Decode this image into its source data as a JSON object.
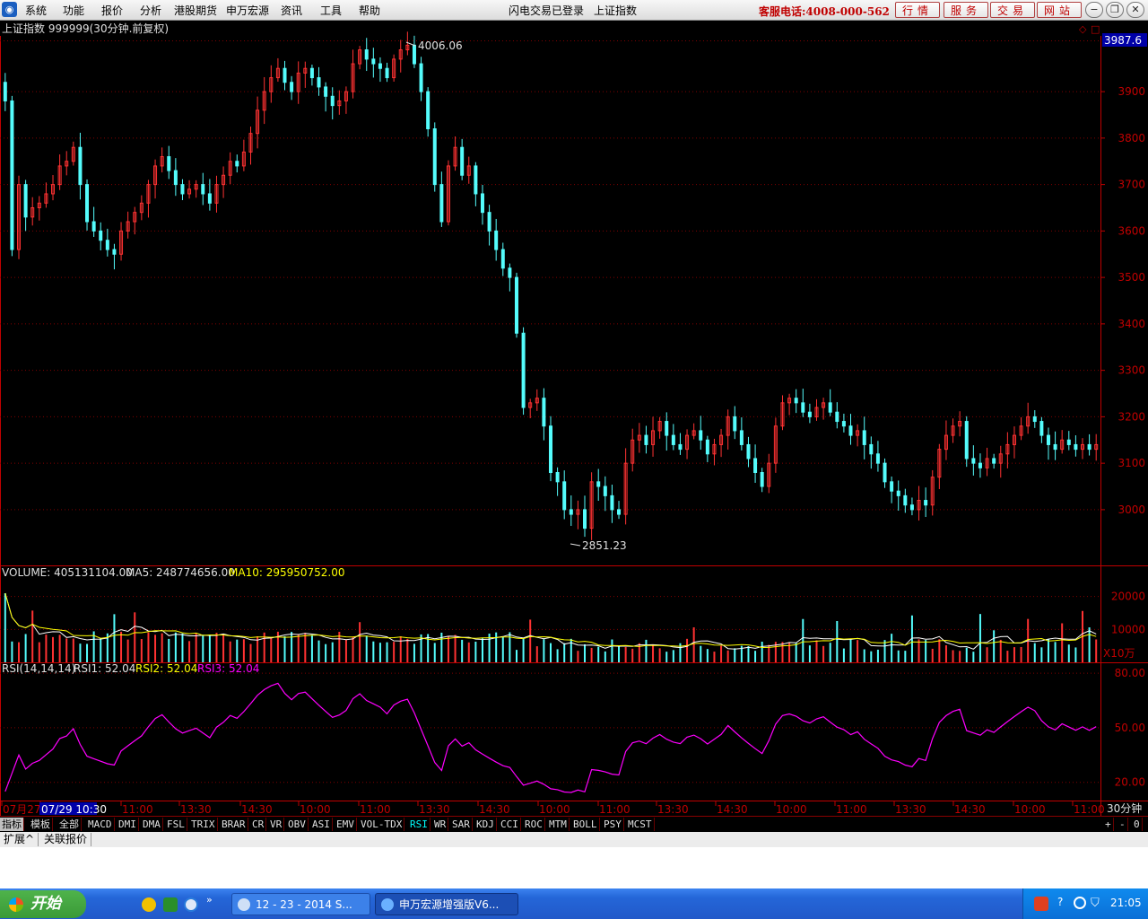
{
  "menu": {
    "items": [
      "系统",
      "功能",
      "报价",
      "分析",
      "港股期货",
      "申万宏源",
      "资讯",
      "工具",
      "帮助"
    ],
    "status": "闪电交易已登录",
    "index_name": "上证指数",
    "hotline": "客服电话:4008-000-562",
    "right_buttons": [
      "行情",
      "服务",
      "交易",
      "网站"
    ]
  },
  "header": {
    "title": "上证指数 999999(30分钟.前复权)",
    "current_price": "3987.6"
  },
  "chart_data": {
    "type": "candlestick",
    "price_axis": {
      "ticks": [
        3000,
        3100,
        3200,
        3300,
        3400,
        3500,
        3600,
        3700,
        3800,
        3900
      ],
      "ylim": [
        2880,
        4020
      ]
    },
    "annotations": [
      {
        "label": "4006.06",
        "value": 4006.06
      },
      {
        "label": "2851.23",
        "value": 2851.23
      }
    ],
    "close": [
      3880,
      3560,
      3700,
      3630,
      3650,
      3660,
      3680,
      3700,
      3740,
      3750,
      3780,
      3700,
      3620,
      3600,
      3580,
      3560,
      3550,
      3600,
      3620,
      3640,
      3660,
      3700,
      3740,
      3760,
      3730,
      3700,
      3680,
      3690,
      3700,
      3680,
      3660,
      3700,
      3720,
      3750,
      3740,
      3770,
      3810,
      3860,
      3900,
      3930,
      3950,
      3920,
      3900,
      3940,
      3950,
      3930,
      3910,
      3890,
      3870,
      3880,
      3900,
      3960,
      3990,
      3970,
      3960,
      3950,
      3930,
      3970,
      3990,
      4000,
      3960,
      3900,
      3820,
      3700,
      3620,
      3740,
      3780,
      3720,
      3740,
      3680,
      3640,
      3600,
      3560,
      3520,
      3500,
      3380,
      3220,
      3230,
      3240,
      3180,
      3080,
      3060,
      3000,
      2990,
      3000,
      2960,
      3060,
      3050,
      3030,
      3000,
      2990,
      3100,
      3150,
      3160,
      3140,
      3170,
      3190,
      3160,
      3140,
      3130,
      3160,
      3170,
      3150,
      3120,
      3140,
      3160,
      3200,
      3170,
      3140,
      3110,
      3080,
      3050,
      3100,
      3180,
      3230,
      3240,
      3230,
      3210,
      3200,
      3220,
      3230,
      3210,
      3190,
      3180,
      3160,
      3170,
      3140,
      3120,
      3100,
      3060,
      3040,
      3030,
      3010,
      3000,
      3020,
      3010,
      3070,
      3130,
      3160,
      3180,
      3190,
      3110,
      3100,
      3090,
      3110,
      3100,
      3120,
      3140,
      3160,
      3180,
      3200,
      3190,
      3160,
      3140,
      3130,
      3150,
      3140,
      3130,
      3140,
      3130,
      3140
    ],
    "volume_panel": {
      "label": "VOLUME: 405131104.00",
      "ma5_label": "MA5: 248774656.00",
      "ma10_label": "MA10: 295950752.00",
      "ticks": [
        10000,
        20000
      ],
      "unit": "X10万",
      "ylim": [
        0,
        24000
      ]
    },
    "rsi_panel": {
      "label": "RSI(14,14,14)",
      "rsi1": "RSI1: 52.04",
      "rsi2": "RSI2: 52.04",
      "rsi3": "RSI3: 52.04",
      "ticks": [
        "20.00",
        "50.00",
        "80.00"
      ],
      "ylim": [
        10,
        85
      ]
    },
    "time_axis": {
      "labels": [
        "07月27",
        "07/29 10:30",
        "11:00",
        "13:30",
        "14:30",
        "10:00",
        "11:00",
        "13:30",
        "14:30",
        "10:00",
        "11:00",
        "13:30",
        "14:30",
        "10:00",
        "11:00",
        "13:30",
        "14:30",
        "10:00",
        "11:00"
      ],
      "period": "30分钟"
    }
  },
  "tabs": [
    "指标",
    "模板",
    "全部",
    "MACD",
    "DMI",
    "DMA",
    "FSL",
    "TRIX",
    "BRAR",
    "CR",
    "VR",
    "OBV",
    "ASI",
    "EMV",
    "VOL-TDX",
    "RSI",
    "WR",
    "SAR",
    "KDJ",
    "CCI",
    "ROC",
    "MTM",
    "BOLL",
    "PSY",
    "MCST"
  ],
  "active_tab": "RSI",
  "tab_tools": [
    "+",
    "-",
    "0"
  ],
  "ext_tabs": [
    "扩展^",
    "关联报价"
  ],
  "taskbar": {
    "start": "开始",
    "tasks": [
      "12 - 23 - 2014 S...",
      "申万宏源增强版V6..."
    ],
    "clock": "21:05"
  },
  "colors": {
    "up": "#ff3232",
    "down": "#54fcfc",
    "ma5": "#ffffff",
    "ma10": "#ffff00",
    "rsi": "#ff00ff",
    "grid": "#800000",
    "axis": "#c00000"
  }
}
